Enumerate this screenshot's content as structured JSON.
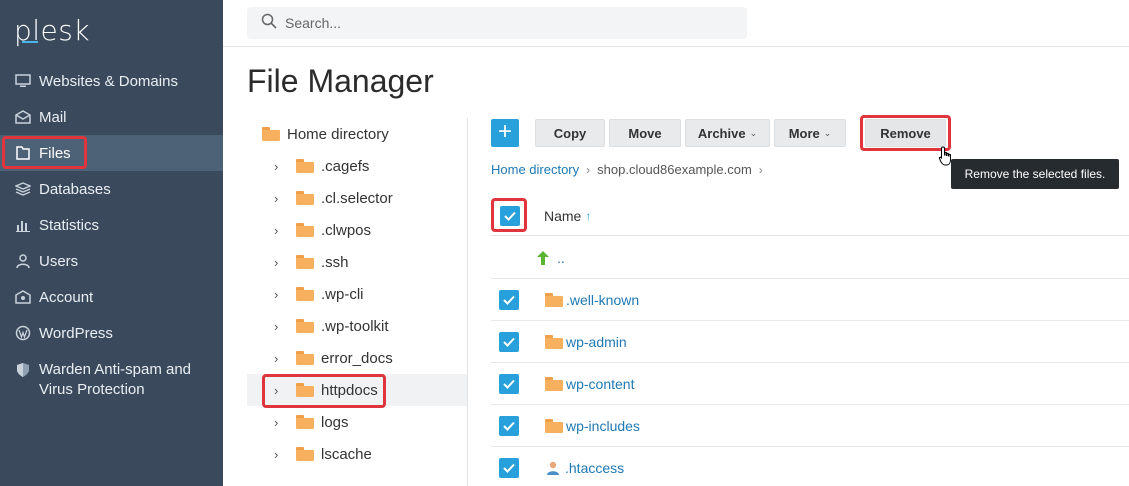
{
  "sidebar": {
    "logo": "plesk",
    "items": [
      {
        "label": "Websites & Domains",
        "icon": "monitor-icon"
      },
      {
        "label": "Mail",
        "icon": "mail-icon"
      },
      {
        "label": "Files",
        "icon": "file-icon"
      },
      {
        "label": "Databases",
        "icon": "database-icon"
      },
      {
        "label": "Statistics",
        "icon": "bar-chart-icon"
      },
      {
        "label": "Users",
        "icon": "user-icon"
      },
      {
        "label": "Account",
        "icon": "account-icon"
      },
      {
        "label": "WordPress",
        "icon": "wordpress-icon"
      },
      {
        "label": "Warden Anti-spam and",
        "label2": "Virus Protection",
        "icon": "shield-icon"
      }
    ]
  },
  "search": {
    "placeholder": "Search..."
  },
  "page": {
    "title": "File Manager"
  },
  "tree": {
    "root": "Home directory",
    "items": [
      ".cagefs",
      ".cl.selector",
      ".clwpos",
      ".ssh",
      ".wp-cli",
      ".wp-toolkit",
      "error_docs",
      "httpdocs",
      "logs",
      "lscache"
    ]
  },
  "toolbar": {
    "add": "+",
    "copy": "Copy",
    "move": "Move",
    "archive": "Archive",
    "more": "More",
    "remove": "Remove",
    "caret": "⌄"
  },
  "tooltip": {
    "text": "Remove the selected files."
  },
  "breadcrumb": {
    "home": "Home directory",
    "current": "shop.cloud86example.com",
    "sep": "›"
  },
  "list": {
    "header": "Name",
    "sort_indicator": "↑",
    "up": "..",
    "rows": [
      ".well-known",
      "wp-admin",
      "wp-content",
      "wp-includes",
      ".htaccess"
    ]
  },
  "colors": {
    "accent": "#27a0dc",
    "highlight": "#e0353c",
    "sidebar": "#3a4a5c"
  }
}
